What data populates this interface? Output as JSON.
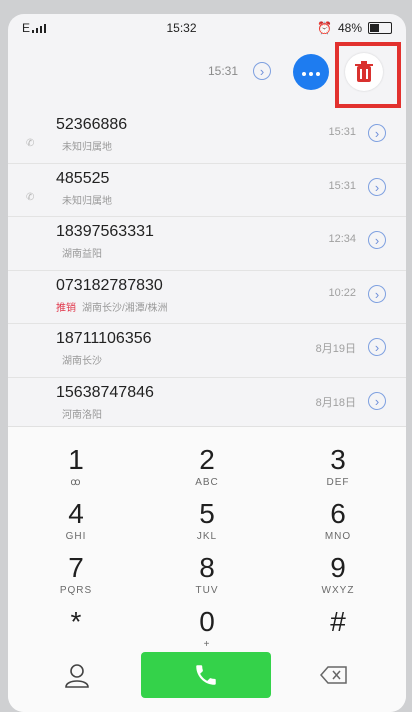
{
  "status_bar": {
    "carrier": "E",
    "time": "15:32",
    "battery": "48%"
  },
  "top_bar": {
    "time": "15:31"
  },
  "call_log": [
    {
      "number": "52366886",
      "location": "未知归属地",
      "time": "15:31",
      "tag": ""
    },
    {
      "number": "485525",
      "location": "未知归属地",
      "time": "15:31",
      "tag": ""
    },
    {
      "number": "18397563331",
      "location": "湖南益阳",
      "time": "12:34",
      "tag": ""
    },
    {
      "number": "073182787830",
      "location": "湖南长沙/湘潭/株洲",
      "time": "10:22",
      "tag": "推销"
    },
    {
      "number": "18711106356",
      "location": "湖南长沙",
      "time": "8月19日",
      "tag": ""
    },
    {
      "number": "15638747846",
      "location": "河南洛阳",
      "time": "8月18日",
      "tag": ""
    }
  ],
  "keypad": [
    {
      "digit": "1",
      "letters": "ꝏ"
    },
    {
      "digit": "2",
      "letters": "ABC"
    },
    {
      "digit": "3",
      "letters": "DEF"
    },
    {
      "digit": "4",
      "letters": "GHI"
    },
    {
      "digit": "5",
      "letters": "JKL"
    },
    {
      "digit": "6",
      "letters": "MNO"
    },
    {
      "digit": "7",
      "letters": "PQRS"
    },
    {
      "digit": "8",
      "letters": "TUV"
    },
    {
      "digit": "9",
      "letters": "WXYZ"
    },
    {
      "digit": "*",
      "letters": ""
    },
    {
      "digit": "0",
      "letters": "+"
    },
    {
      "digit": "#",
      "letters": ""
    }
  ],
  "colors": {
    "accent_blue": "#1e7cf0",
    "call_green": "#34d24a",
    "highlight_red": "#e2312e",
    "delete_icon": "#d9322f"
  },
  "icons": [
    "signal-icon",
    "alarm-icon",
    "battery-icon",
    "chevron-right-icon",
    "message-icon",
    "trash-icon",
    "phone-icon",
    "contacts-icon",
    "backspace-icon"
  ]
}
